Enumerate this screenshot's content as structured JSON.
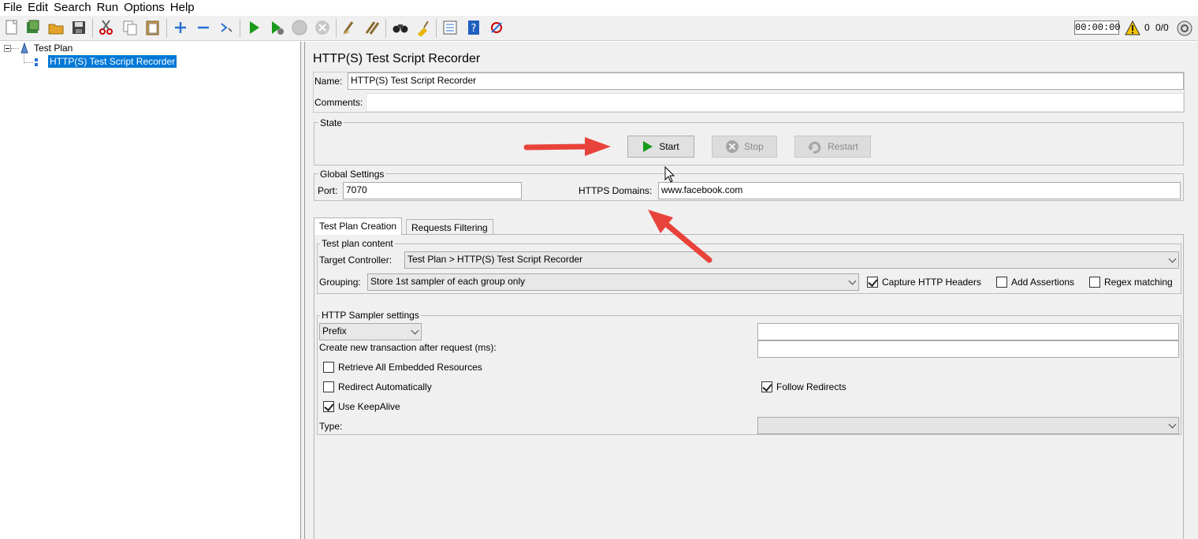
{
  "menu": {
    "file": "File",
    "edit": "Edit",
    "search": "Search",
    "run": "Run",
    "options": "Options",
    "help": "Help"
  },
  "toolbar": {
    "timer": "00:00:00",
    "warn_count": "0",
    "thread_count": "0/0"
  },
  "tree": {
    "root": "Test Plan",
    "child": "HTTP(S) Test Script Recorder"
  },
  "panel": {
    "title": "HTTP(S) Test Script Recorder",
    "name_label": "Name:",
    "name_value": "HTTP(S) Test Script Recorder",
    "comments_label": "Comments:",
    "comments_value": "",
    "state_title": "State",
    "start": "Start",
    "stop": "Stop",
    "restart": "Restart",
    "global_title": "Global Settings",
    "port_label": "Port:",
    "port_value": "7070",
    "https_label": "HTTPS Domains:",
    "https_value": "www.facebook.com"
  },
  "tabs": {
    "creation": "Test Plan Creation",
    "filtering": "Requests Filtering"
  },
  "content": {
    "title": "Test plan content",
    "target_label": "Target Controller:",
    "target_value": "Test Plan > HTTP(S) Test Script Recorder",
    "grouping_label": "Grouping:",
    "grouping_value": "Store 1st sampler of each group only",
    "capture_headers": "Capture HTTP Headers",
    "add_assertions": "Add Assertions",
    "regex": "Regex matching"
  },
  "sampler": {
    "title": "HTTP Sampler settings",
    "prefix_value": "Prefix",
    "prefix_text": "",
    "transaction_label": "Create new transaction after request (ms):",
    "transaction_value": "",
    "retrieve": "Retrieve All Embedded Resources",
    "redirect": "Redirect Automatically",
    "follow": "Follow Redirects",
    "keepalive": "Use KeepAlive",
    "type_label": "Type:",
    "type_value": ""
  },
  "checks": {
    "capture_headers": true,
    "add_assertions": false,
    "regex": false,
    "retrieve": false,
    "redirect": false,
    "follow": true,
    "keepalive": true
  },
  "colors": {
    "accent": "#0078d7",
    "arrow": "#e8433b",
    "start_green": "#1a9a1a"
  }
}
